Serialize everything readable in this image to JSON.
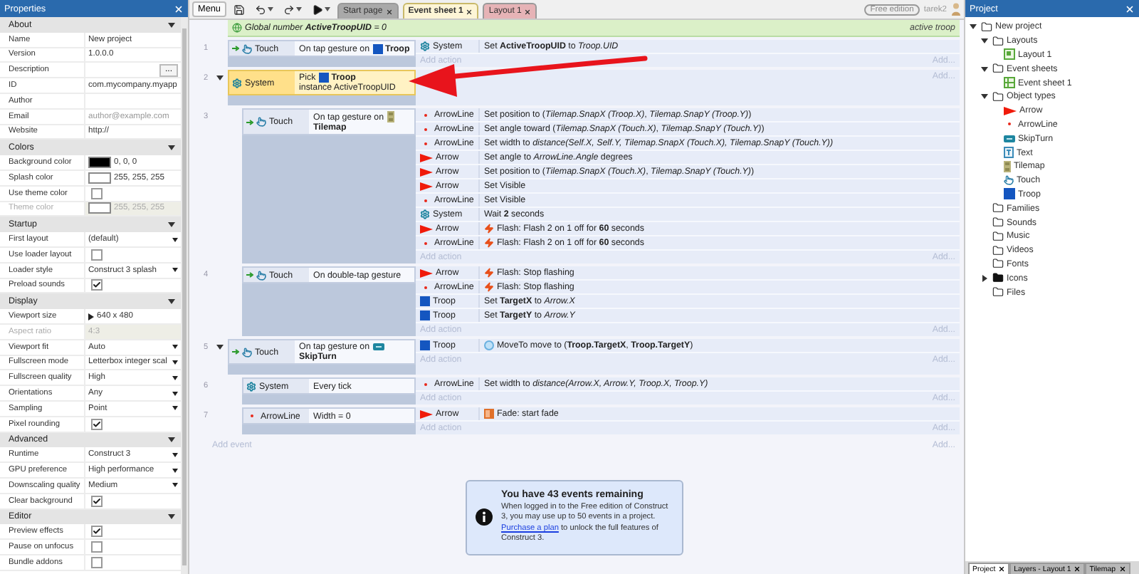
{
  "properties": {
    "title": "Properties",
    "sections": [
      {
        "title": "About",
        "expanded": true,
        "rows": [
          {
            "kind": "text",
            "label": "Name",
            "value": "New project",
            "disabled": false
          },
          {
            "kind": "text",
            "label": "Version",
            "value": "1.0.0.0",
            "disabled": false
          },
          {
            "kind": "button",
            "label": "Description",
            "button": "...",
            "disabled": false
          },
          {
            "kind": "text",
            "label": "ID",
            "value": "com.mycompany.myapp",
            "disabled": false
          },
          {
            "kind": "text",
            "label": "Author",
            "disabled": false
          },
          {
            "kind": "text",
            "label": "Email",
            "placeholder": "author@example.com",
            "disabled": false
          },
          {
            "kind": "text",
            "label": "Website",
            "value": "http://",
            "disabled": false
          }
        ]
      },
      {
        "title": "Colors",
        "expanded": true,
        "rows": [
          {
            "kind": "color",
            "label": "Background color",
            "color": "#000000",
            "value": "0, 0, 0",
            "disabled": false
          },
          {
            "kind": "color",
            "label": "Splash color",
            "color": "#ffffff",
            "value": "255, 255, 255",
            "disabled": false
          },
          {
            "kind": "checkbox",
            "label": "Use theme color",
            "checked": false,
            "disabled": false
          },
          {
            "kind": "color",
            "label": "Theme color",
            "color": "#ffffff",
            "value": "255, 255, 255",
            "disabled": true
          }
        ]
      },
      {
        "title": "Startup",
        "expanded": true,
        "rows": [
          {
            "kind": "select",
            "label": "First layout",
            "value": "(default)",
            "disabled": false
          },
          {
            "kind": "checkbox",
            "label": "Use loader layout",
            "checked": false,
            "disabled": false
          },
          {
            "kind": "select",
            "label": "Loader style",
            "value": "Construct 3 splash",
            "disabled": false
          },
          {
            "kind": "checkbox",
            "label": "Preload sounds",
            "checked": true,
            "disabled": false
          }
        ]
      },
      {
        "title": "Display",
        "expanded": true,
        "rows": [
          {
            "kind": "size",
            "label": "Viewport size",
            "value": "640 x 480",
            "disabled": false
          },
          {
            "kind": "text",
            "label": "Aspect ratio",
            "value": "4:3",
            "disabled": true
          },
          {
            "kind": "select",
            "label": "Viewport fit",
            "value": "Auto",
            "disabled": false
          },
          {
            "kind": "select",
            "label": "Fullscreen mode",
            "value": "Letterbox integer scal",
            "disabled": false
          },
          {
            "kind": "select",
            "label": "Fullscreen quality",
            "value": "High",
            "disabled": false
          },
          {
            "kind": "select",
            "label": "Orientations",
            "value": "Any",
            "disabled": false
          },
          {
            "kind": "select",
            "label": "Sampling",
            "value": "Point",
            "disabled": false
          },
          {
            "kind": "checkbox",
            "label": "Pixel rounding",
            "checked": true,
            "disabled": false
          }
        ]
      },
      {
        "title": "Advanced",
        "expanded": true,
        "rows": [
          {
            "kind": "select",
            "label": "Runtime",
            "value": "Construct 3",
            "disabled": false
          },
          {
            "kind": "select",
            "label": "GPU preference",
            "value": "High performance",
            "disabled": false
          },
          {
            "kind": "select",
            "label": "Downscaling quality",
            "value": "Medium",
            "disabled": false
          },
          {
            "kind": "checkbox",
            "label": "Clear background",
            "checked": true,
            "disabled": false
          }
        ]
      },
      {
        "title": "Editor",
        "expanded": true,
        "rows": [
          {
            "kind": "checkbox",
            "label": "Preview effects",
            "checked": true,
            "disabled": false
          },
          {
            "kind": "checkbox",
            "label": "Pause on unfocus",
            "checked": false,
            "disabled": false
          },
          {
            "kind": "checkbox",
            "label": "Bundle addons",
            "checked": false,
            "disabled": false
          }
        ]
      }
    ]
  },
  "toolbar": {
    "menu": "Menu",
    "tabs": [
      {
        "label": "Start page",
        "selected": false,
        "color": "#a9a9a9"
      },
      {
        "label": "Event sheet 1",
        "selected": true,
        "color": "#fdf5d6"
      },
      {
        "label": "Layout 1",
        "selected": false,
        "color": "#e6b3b6"
      }
    ],
    "edition": "Free edition",
    "user": "tarek2"
  },
  "event_sheet": {
    "global_variable": {
      "text": "Global number **ActiveTroopUID** = 0",
      "note": "active troop"
    },
    "events": [
      {
        "number": "1",
        "selected": false,
        "trigger": true,
        "condition": {
          "kind": "touch",
          "object": "Touch",
          "text": "On tap gesture on",
          "target": {
            "kind": "troop",
            "name": "Troop"
          }
        },
        "actions": [
          {
            "kind": "system",
            "object": "System",
            "text": "Set **ActiveTroopUID** to *Troop.UID*"
          }
        ],
        "add_action": "Add action",
        "add_more": "Add..."
      },
      {
        "number": "2",
        "selected": true,
        "expanded": true,
        "trigger": false,
        "condition": {
          "kind": "system",
          "object": "System",
          "text": "Pick",
          "target": {
            "kind": "troop",
            "name": "Troop"
          },
          "after": "instance ActiveTroopUID"
        },
        "add_more": "Add...",
        "children": [
          {
            "number": "3",
            "selected": false,
            "trigger": true,
            "condition": {
              "kind": "touch",
              "object": "Touch",
              "text": "On tap gesture on",
              "target": {
                "kind": "tilemap",
                "name": "Tilemap"
              }
            },
            "actions": [
              {
                "kind": "arrowline",
                "object": "ArrowLine",
                "text": "Set position to (*Tilemap.SnapX (Troop.X)*, *Tilemap.SnapY (Troop.Y)*)"
              },
              {
                "kind": "arrowline",
                "object": "ArrowLine",
                "text": "Set angle toward (*Tilemap.SnapX (Touch.X)*, *Tilemap.SnapY (Touch.Y)*)"
              },
              {
                "kind": "arrowline",
                "object": "ArrowLine",
                "text": "Set width to *distance(Self.X, Self.Y, Tilemap.SnapX (Touch.X), Tilemap.SnapY (Touch.Y))*"
              },
              {
                "kind": "arrow",
                "object": "Arrow",
                "text": "Set angle to *ArrowLine.Angle* degrees"
              },
              {
                "kind": "arrow",
                "object": "Arrow",
                "text": "Set position to (*Tilemap.SnapX (Touch.X)*, *Tilemap.SnapY (Touch.Y)*)"
              },
              {
                "kind": "arrow",
                "object": "Arrow",
                "text": "Set Visible"
              },
              {
                "kind": "arrowline",
                "object": "ArrowLine",
                "text": "Set Visible"
              },
              {
                "kind": "system",
                "object": "System",
                "text": "Wait **2** seconds"
              },
              {
                "kind": "arrow_flash",
                "object": "Arrow",
                "text": "Flash: Flash 2 on 1 off for **60** seconds"
              },
              {
                "kind": "arrowline_flash",
                "object": "ArrowLine",
                "text": "Flash: Flash 2 on 1 off for **60** seconds"
              }
            ],
            "add_action": "Add action",
            "add_more": "Add..."
          },
          {
            "number": "4",
            "selected": false,
            "trigger": true,
            "condition": {
              "kind": "touch",
              "object": "Touch",
              "text": "On double-tap gesture"
            },
            "actions": [
              {
                "kind": "arrow_flash",
                "object": "Arrow",
                "text": "Flash: Stop flashing"
              },
              {
                "kind": "arrowline_flash",
                "object": "ArrowLine",
                "text": "Flash: Stop flashing"
              },
              {
                "kind": "troop",
                "object": "Troop",
                "text": "Set **TargetX** to *Arrow.X*"
              },
              {
                "kind": "troop",
                "object": "Troop",
                "text": "Set **TargetY** to *Arrow.Y*"
              }
            ],
            "add_action": "Add action",
            "add_more": "Add..."
          }
        ]
      },
      {
        "number": "5",
        "selected": false,
        "expanded": true,
        "trigger": true,
        "condition": {
          "kind": "touch",
          "object": "Touch",
          "text": "On tap gesture on",
          "target": {
            "kind": "skipturn",
            "name": "SkipTurn"
          }
        },
        "actions": [
          {
            "kind": "troop_moveto",
            "object": "Troop",
            "text": "MoveTo move to (**Troop.TargetX**, **Troop.TargetY**)"
          }
        ],
        "add_action": "Add action",
        "add_more": "Add...",
        "children": [
          {
            "number": "6",
            "selected": false,
            "trigger": false,
            "condition": {
              "kind": "system",
              "object": "System",
              "text": "Every tick"
            },
            "actions": [
              {
                "kind": "arrowline",
                "object": "ArrowLine",
                "text": "Set width to *distance(Arrow.X, Arrow.Y, Troop.X, Troop.Y)*"
              }
            ],
            "add_action": "Add action",
            "add_more": "Add..."
          },
          {
            "number": "7",
            "selected": false,
            "trigger": false,
            "condition": {
              "kind": "arrowline",
              "object": "ArrowLine",
              "text": "Width = 0"
            },
            "actions": [
              {
                "kind": "arrow_fade",
                "object": "Arrow",
                "text": "Fade: start fade"
              }
            ],
            "add_action": "Add action",
            "add_more": "Add..."
          }
        ]
      }
    ],
    "add_event": "Add event",
    "add_more": "Add..."
  },
  "info": {
    "title": "You have 43 events remaining",
    "before": "When logged in to the Free edition of Construct 3, you may use up to 50 events in a project.",
    "link": "Purchase a plan",
    "after": "to unlock the full features of Construct 3."
  },
  "project": {
    "title": "Project",
    "tree": [
      {
        "label": "New project",
        "kind": "folder",
        "expanded": true,
        "children": [
          {
            "label": "Layouts",
            "kind": "folder",
            "expanded": true,
            "children": [
              {
                "label": "Layout 1",
                "kind": "layout"
              }
            ]
          },
          {
            "label": "Event sheets",
            "kind": "folder",
            "expanded": true,
            "children": [
              {
                "label": "Event sheet 1",
                "kind": "eventsheet"
              }
            ]
          },
          {
            "label": "Object types",
            "kind": "folder",
            "expanded": true,
            "children": [
              {
                "label": "Arrow",
                "kind": "arrow"
              },
              {
                "label": "ArrowLine",
                "kind": "arrowline"
              },
              {
                "label": "SkipTurn",
                "kind": "skipturn"
              },
              {
                "label": "Text",
                "kind": "text"
              },
              {
                "label": "Tilemap",
                "kind": "tilemap"
              },
              {
                "label": "Touch",
                "kind": "touch"
              },
              {
                "label": "Troop",
                "kind": "troopbig"
              }
            ]
          },
          {
            "label": "Families",
            "kind": "folder"
          },
          {
            "label": "Sounds",
            "kind": "folder"
          },
          {
            "label": "Music",
            "kind": "folder"
          },
          {
            "label": "Videos",
            "kind": "folder"
          },
          {
            "label": "Fonts",
            "kind": "folder"
          },
          {
            "label": "Icons",
            "kind": "folderdark",
            "expanded": false
          },
          {
            "label": "Files",
            "kind": "folder"
          }
        ]
      }
    ],
    "tabs": [
      {
        "label": "Project",
        "selected": true
      },
      {
        "label": "Layers - Layout 1",
        "selected": false
      },
      {
        "label": "Tilemap",
        "selected": false
      }
    ]
  }
}
